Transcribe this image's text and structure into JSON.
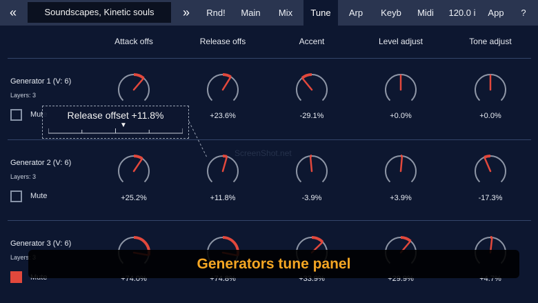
{
  "topbar": {
    "back_icon": "«",
    "preset_name": "Soundscapes, Kinetic souls",
    "forward_icon": "»",
    "tabs": [
      {
        "label": "Rnd!",
        "active": false
      },
      {
        "label": "Main",
        "active": false
      },
      {
        "label": "Mix",
        "active": false
      },
      {
        "label": "Tune",
        "active": true
      },
      {
        "label": "Arp",
        "active": false
      },
      {
        "label": "Keyb",
        "active": false
      },
      {
        "label": "Midi",
        "active": false
      },
      {
        "label": "120.0 i",
        "active": false
      },
      {
        "label": "App",
        "active": false
      },
      {
        "label": "?",
        "active": false
      }
    ]
  },
  "columns": [
    "Attack offs",
    "Release offs",
    "Accent",
    "Level adjust",
    "Tone adjust"
  ],
  "generators": [
    {
      "name": "Generator 1 (V: 6)",
      "layers": "Layers: 3",
      "mute_label": "Mute",
      "muted": false,
      "knobs": [
        {
          "value_text": "",
          "value": 0.3
        },
        {
          "value_text": "+23.6%",
          "value": 0.236
        },
        {
          "value_text": "-29.1%",
          "value": -0.291
        },
        {
          "value_text": "+0.0%",
          "value": 0.0
        },
        {
          "value_text": "+0.0%",
          "value": 0.0
        }
      ]
    },
    {
      "name": "Generator 2 (V: 6)",
      "layers": "Layers: 3",
      "mute_label": "Mute",
      "muted": false,
      "knobs": [
        {
          "value_text": "+25.2%",
          "value": 0.252
        },
        {
          "value_text": "+11.8%",
          "value": 0.118
        },
        {
          "value_text": "-3.9%",
          "value": -0.039
        },
        {
          "value_text": "+3.9%",
          "value": 0.039
        },
        {
          "value_text": "-17.3%",
          "value": -0.173
        }
      ]
    },
    {
      "name": "Generator 3 (V: 6)",
      "layers": "Layers: 3",
      "mute_label": "Mute",
      "muted": true,
      "knobs": [
        {
          "value_text": "+74.0%",
          "value": 0.74
        },
        {
          "value_text": "+74.8%",
          "value": 0.748
        },
        {
          "value_text": "+33.9%",
          "value": 0.339
        },
        {
          "value_text": "+29.9%",
          "value": 0.299
        },
        {
          "value_text": "+4.7%",
          "value": 0.047
        }
      ]
    }
  ],
  "tooltip": {
    "text": "Release offset +11.8%",
    "marker": "▼",
    "value": 0.118
  },
  "watermark": "ScreenShot.net",
  "caption": "Generators tune panel",
  "colors": {
    "accent": "#e2483c",
    "track": "#8e96a6",
    "caption": "#f5a623",
    "background": "#0d1730",
    "topbar": "#2a3550"
  }
}
